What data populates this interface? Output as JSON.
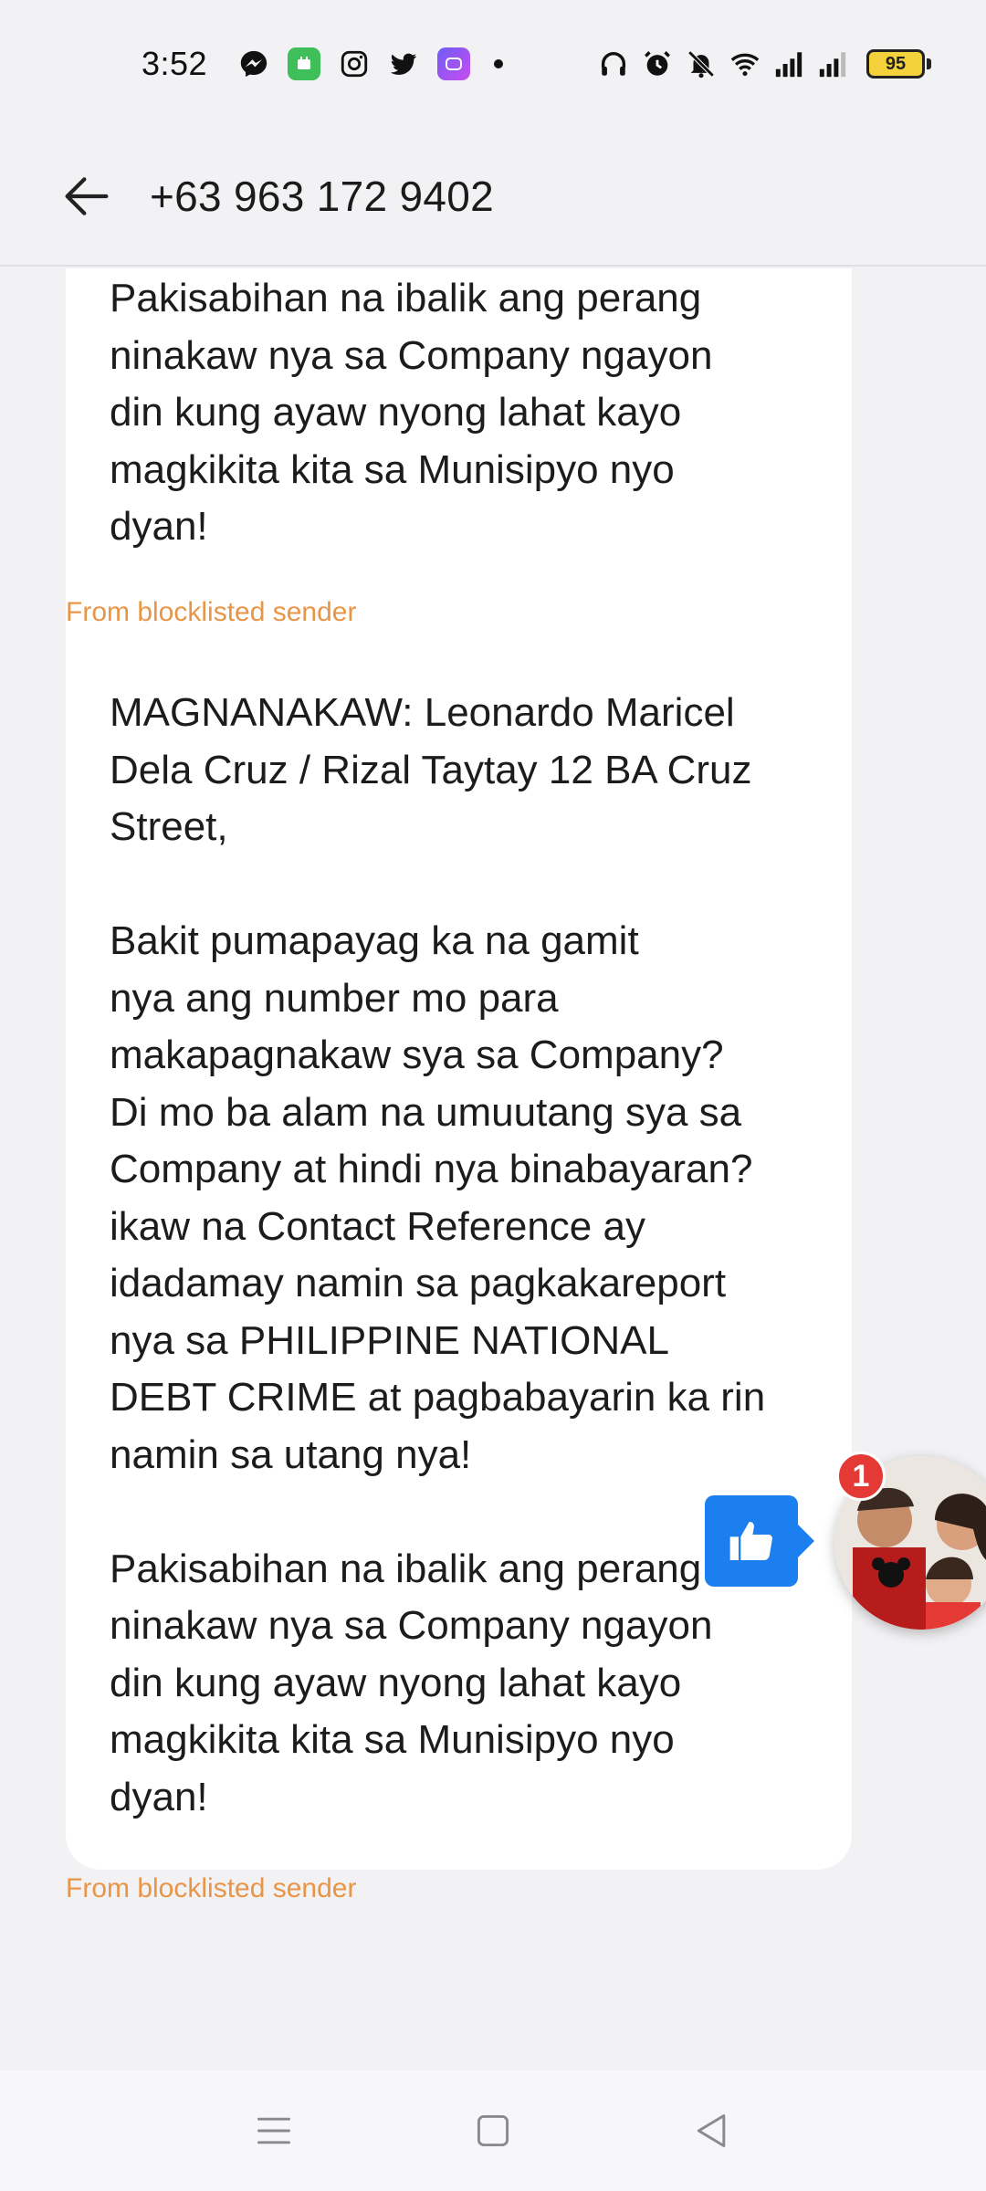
{
  "status_bar": {
    "time": "3:52",
    "left_icons": [
      "messenger-icon",
      "app-icon",
      "instagram-icon",
      "twitter-icon",
      "app-icon",
      "dot-icon"
    ],
    "right_icons": [
      "headphones-icon",
      "alarm-icon",
      "mute-icon",
      "wifi-icon",
      "signal-icon",
      "signal-icon"
    ],
    "battery": "95"
  },
  "header": {
    "title": "+63 963 172 9402",
    "back_icon": "arrow-left-icon"
  },
  "messages": [
    {
      "text": "Pakisabihan na ibalik ang perang\nninakaw nya sa Company ngayon\ndin kung ayaw nyong lahat kayo\nmagkikita kita sa Munisipyo nyo\ndyan!",
      "label": "From blocklisted sender"
    },
    {
      "text": "MAGNANAKAW: Leonardo Maricel\nDela Cruz / Rizal Taytay 12 BA Cruz\nStreet,\n\nBakit pumapayag ka na gamit\nnya ang number mo para\nmakapagnakaw sya sa Company?\nDi mo ba alam na umuutang sya sa\nCompany at hindi nya binabayaran?\nikaw na Contact Reference ay\nidadamay namin sa pagkakareport\nnya sa PHILIPPINE NATIONAL\nDEBT CRIME at pagbabayarin ka rin\nnamin sa utang nya!\n\nPakisabihan na ibalik ang perang\nninakaw nya sa Company ngayon\ndin kung ayaw nyong lahat kayo\nmagkikita kita sa Munisipyo nyo\ndyan!",
      "label": "From blocklisted sender"
    }
  ],
  "chat_head": {
    "badge_count": "1",
    "like_icon": "thumbs-up-icon"
  },
  "colors": {
    "blocked_label": "#e89548",
    "bubble": "#ffffff",
    "background": "#f2f2f4",
    "badge": "#e53935",
    "like_button": "#1b7ff0"
  },
  "nav_bar": {
    "icons": [
      "menu-icon",
      "home-square-icon",
      "back-triangle-icon"
    ]
  }
}
